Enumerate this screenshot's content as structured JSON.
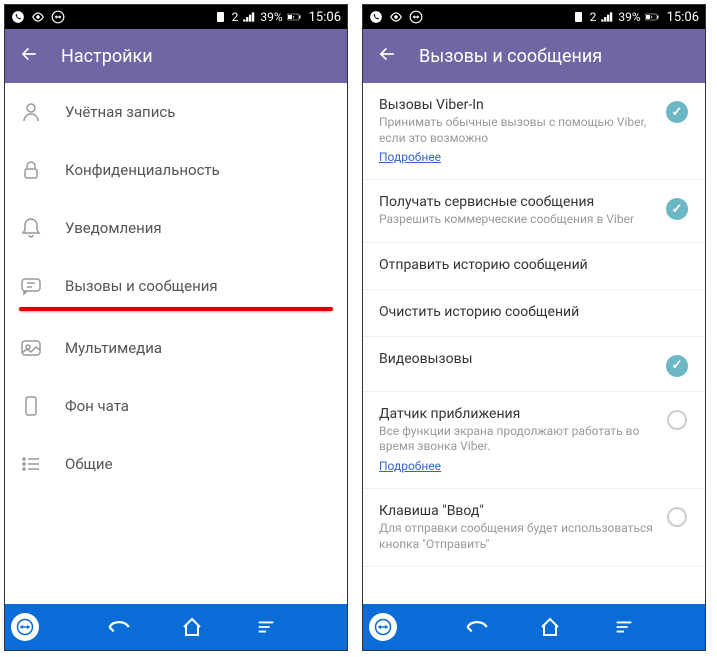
{
  "status": {
    "battery": "39%",
    "time": "15:06",
    "sim": "2"
  },
  "left": {
    "title": "Настройки",
    "items": [
      {
        "label": "Учётная запись",
        "icon": "user"
      },
      {
        "label": "Конфиденциальность",
        "icon": "lock"
      },
      {
        "label": "Уведомления",
        "icon": "bell"
      },
      {
        "label": "Вызовы и сообщения",
        "icon": "chat"
      },
      {
        "label": "Мультимедиа",
        "icon": "media"
      },
      {
        "label": "Фон чата",
        "icon": "phone"
      },
      {
        "label": "Общие",
        "icon": "list"
      }
    ]
  },
  "right": {
    "title": "Вызовы и сообщения",
    "moreLink": "Подробнее",
    "settings": [
      {
        "title": "Вызовы Viber-In",
        "desc": "Принимать обычные вызовы с помощью Viber, если это возможно",
        "link": true,
        "checked": true
      },
      {
        "title": "Получать сервисные сообщения",
        "desc": "Разрешить коммерческие сообщения в Viber",
        "checked": true
      },
      {
        "title": "Отправить историю сообщений"
      },
      {
        "title": "Очистить историю сообщений"
      },
      {
        "title": "Видеовызовы",
        "checked": true
      },
      {
        "title": "Датчик приближения",
        "desc": "Все функции экрана продолжают работать во время звонка Viber.",
        "link": true,
        "radio": true
      },
      {
        "title": "Клавиша \"Ввод\"",
        "desc": "Для отправки сообщения будет использоваться кнопка \"Отправить\"",
        "radio": true
      }
    ]
  }
}
